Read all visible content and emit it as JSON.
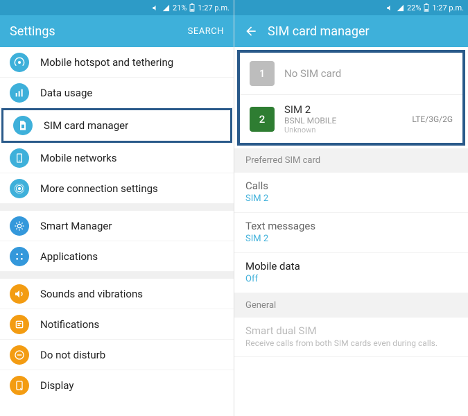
{
  "left": {
    "status": {
      "battery": "21%",
      "time": "1:27 p.m."
    },
    "header": {
      "title": "Settings",
      "search": "SEARCH"
    },
    "items": [
      {
        "label": "Mobile hotspot and tethering"
      },
      {
        "label": "Data usage"
      },
      {
        "label": "SIM card manager"
      },
      {
        "label": "Mobile networks"
      },
      {
        "label": "More connection settings"
      },
      {
        "label": "Smart Manager"
      },
      {
        "label": "Applications"
      },
      {
        "label": "Sounds and vibrations"
      },
      {
        "label": "Notifications"
      },
      {
        "label": "Do not disturb"
      },
      {
        "label": "Display"
      }
    ]
  },
  "right": {
    "status": {
      "battery": "22%",
      "time": "1:27 p.m."
    },
    "header": {
      "title": "SIM card manager"
    },
    "sim1": {
      "badge": "1",
      "label": "No SIM card"
    },
    "sim2": {
      "badge": "2",
      "label": "SIM 2",
      "carrier": "BSNL MOBILE",
      "status": "Unknown",
      "mode": "LTE/3G/2G"
    },
    "section_preferred": "Preferred SIM card",
    "pref": {
      "calls": {
        "label": "Calls",
        "value": "SIM 2"
      },
      "texts": {
        "label": "Text messages",
        "value": "SIM 2"
      },
      "data": {
        "label": "Mobile data",
        "value": "Off"
      }
    },
    "section_general": "General",
    "smartdual": {
      "label": "Smart dual SIM",
      "desc": "Receive calls from both SIM cards even during calls."
    }
  }
}
